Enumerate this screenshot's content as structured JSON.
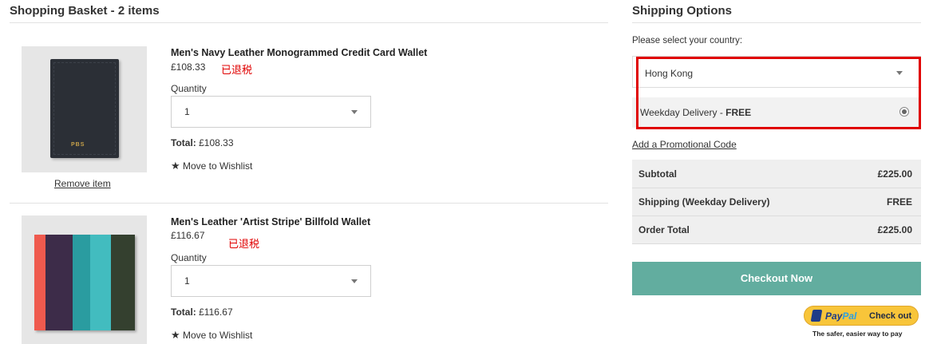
{
  "basket": {
    "title": "Shopping Basket - 2 items",
    "items": [
      {
        "name": "Men's Navy Leather Monogrammed Credit Card Wallet",
        "price": "£108.33",
        "note": "已退税",
        "quantity_label": "Quantity",
        "quantity_value": "1",
        "total_label": "Total:",
        "total_value": "£108.33",
        "wishlist_label": "Move to Wishlist",
        "remove_label": "Remove item",
        "monogram": "PBS"
      },
      {
        "name": "Men's Leather 'Artist Stripe' Billfold Wallet",
        "price": "£116.67",
        "note": "已退税",
        "quantity_label": "Quantity",
        "quantity_value": "1",
        "total_label": "Total:",
        "total_value": "£116.67",
        "wishlist_label": "Move to Wishlist"
      }
    ]
  },
  "shipping": {
    "title": "Shipping Options",
    "country_prompt": "Please select your country:",
    "country_value": "Hong Kong",
    "delivery_label": "Weekday Delivery",
    "delivery_sep": " - ",
    "delivery_price": "FREE",
    "promo_label": "Add a Promotional Code",
    "highlight_color": "#e00000"
  },
  "summary": {
    "subtotal_label": "Subtotal",
    "subtotal_value": "£225.00",
    "shipping_label": "Shipping (Weekday Delivery)",
    "shipping_value": "FREE",
    "order_total_label": "Order Total",
    "order_total_value": "£225.00"
  },
  "checkout": {
    "button_label": "Checkout Now",
    "button_color": "#62ad9f",
    "paypal_brand_pay": "Pay",
    "paypal_brand_pal": "Pal",
    "paypal_label": "Check out",
    "paypal_tagline": "The safer, easier way to pay"
  }
}
